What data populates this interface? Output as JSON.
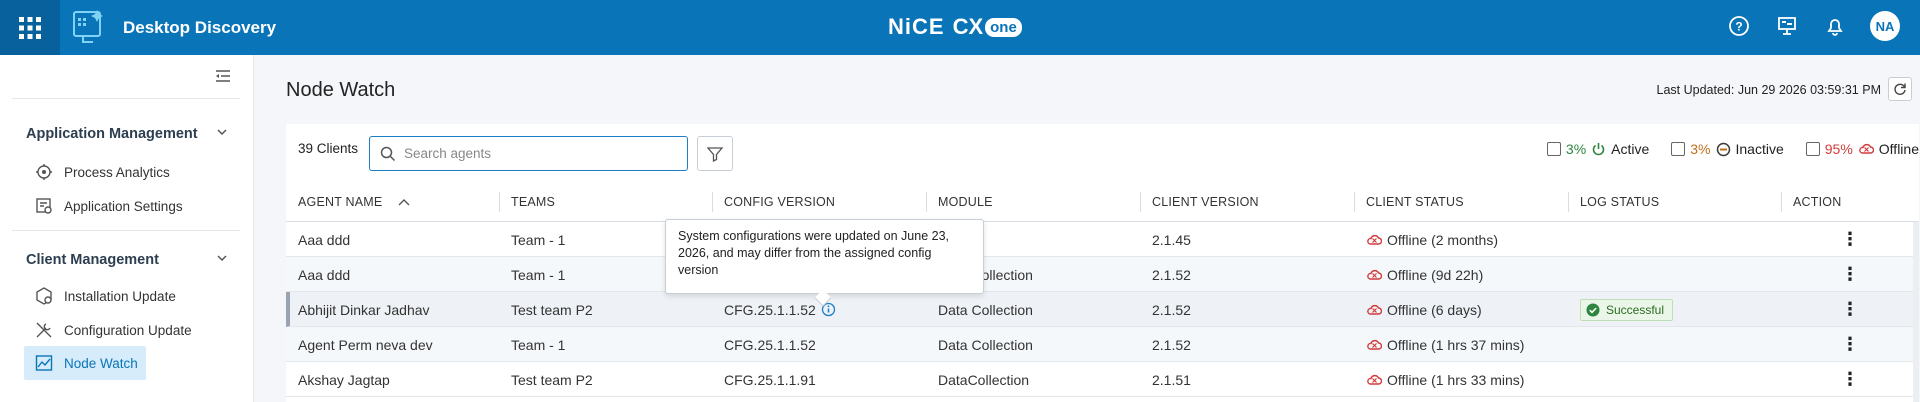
{
  "header": {
    "app_title": "Desktop Discovery",
    "brand_nice": "NiCE",
    "brand_cx": "CX",
    "brand_one": "one",
    "avatar_initials": "NA",
    "icons": [
      "apps-grid-icon",
      "help-icon",
      "presentation-icon",
      "bell-icon"
    ]
  },
  "sidebar": {
    "sections": [
      {
        "title": "Application Management",
        "items": [
          {
            "label": "Process Analytics",
            "icon": "process-analytics-icon"
          },
          {
            "label": "Application Settings",
            "icon": "application-settings-icon"
          }
        ]
      },
      {
        "title": "Client Management",
        "items": [
          {
            "label": "Installation Update",
            "icon": "installation-update-icon"
          },
          {
            "label": "Configuration Update",
            "icon": "configuration-update-icon"
          },
          {
            "label": "Node Watch",
            "icon": "node-watch-icon",
            "active": true
          }
        ]
      }
    ]
  },
  "page": {
    "title": "Node Watch",
    "last_updated": "Last Updated: Jun 29 2026 03:59:31 PM"
  },
  "toolbar": {
    "client_count": "39 Clients",
    "search_placeholder": "Search agents",
    "legend": [
      {
        "pct": "3%",
        "label": "Active",
        "color": "#2e8540"
      },
      {
        "pct": "3%",
        "label": "Inactive",
        "color": "#c0701b"
      },
      {
        "pct": "95%",
        "label": "Offline",
        "color": "#d13b3b"
      }
    ]
  },
  "table": {
    "columns": [
      "AGENT NAME",
      "TEAMS",
      "CONFIG VERSION",
      "MODULE",
      "CLIENT VERSION",
      "CLIENT STATUS",
      "LOG STATUS",
      "ACTION"
    ],
    "sort_column": "AGENT NAME",
    "rows": [
      {
        "agent": "Aaa ddd",
        "team": "Team - 1",
        "config": "",
        "module": "",
        "client_version": "2.1.45",
        "status": "Offline (2 months)",
        "log": ""
      },
      {
        "agent": "Aaa ddd",
        "team": "Team - 1",
        "config": "",
        "module": "Data Collection",
        "client_version": "2.1.52",
        "status": "Offline (9d 22h)",
        "log": ""
      },
      {
        "agent": "Abhijit Dinkar Jadhav",
        "team": "Test team P2",
        "config": "CFG.25.1.1.52",
        "module": "Data Collection",
        "client_version": "2.1.52",
        "status": "Offline (6 days)",
        "log": "Successful"
      },
      {
        "agent": "Agent Perm neva dev",
        "team": "Team - 1",
        "config": "CFG.25.1.1.52",
        "module": "Data Collection",
        "client_version": "2.1.52",
        "status": "Offline (1 hrs 37 mins)",
        "log": ""
      },
      {
        "agent": "Akshay Jagtap",
        "team": "Test team P2",
        "config": "CFG.25.1.1.91",
        "module": "DataCollection",
        "client_version": "2.1.51",
        "status": "Offline (1 hrs 33 mins)",
        "log": ""
      }
    ]
  },
  "tooltip": {
    "text": "System configurations were updated on June 23, 2026, and may differ from the assigned config version"
  }
}
